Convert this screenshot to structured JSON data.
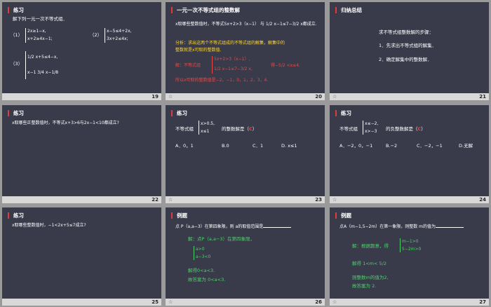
{
  "slides": [
    {
      "number": "19",
      "title": "练习",
      "prompt": "解下列一元一次不等式组．",
      "p1_label": "（1）",
      "p1_l1": "2x≥1−x,",
      "p1_l2": "x+2≥4x−1;",
      "p2_label": "（2）",
      "p2_l1": "x−5≤4+2x,",
      "p2_l2": "3x+2≤4x;",
      "p3_label": "（3）",
      "p3_l1": "1/2 x+5≤4−x,",
      "p3_l2": "x−1  3/4 x−1/8"
    },
    {
      "number": "20",
      "title": "一元一次不等式组的整数解",
      "q1": "x取哪些整数值时，不等式5x+2>3（x−1） 与  1/2 x−1≤7−3/2 x都成立.",
      "analysis1": "分析：求出这两个不等式组成的不等式组的解集，解集中的",
      "analysis2": "整数就是x可取的整数值.",
      "sol_prefix": "解：不等式组",
      "sol_l1": "5x+2>3（x−1）,",
      "sol_l2": "1/2 x−1≤7−3/2 x,",
      "sol_result": "得−5/2 <x≤4.",
      "conclusion": "所以x可取的整数值是−2，−1，0，1，2，3，4."
    },
    {
      "number": "21",
      "title": "归纳总结",
      "heading": "求不等式组整数解的步骤：",
      "step1": "1．先求出不等式组的解集．",
      "step2": "2．确定解集中的整数解．"
    },
    {
      "number": "22",
      "title": "练习",
      "q": "x取哪些正整数值时，不等式x+3>6与2x−1<10都成立?"
    },
    {
      "number": "23",
      "title": "练习",
      "q_prefix": "不等式组",
      "q_l1": "x>0.5,",
      "q_l2": "x≤1",
      "q_suffix": "的整数解是（",
      "answer": "C",
      "q_close": "）",
      "options": [
        "A．0，1",
        "B.0",
        "C．1",
        "D. x≤1"
      ]
    },
    {
      "number": "24",
      "title": "练习",
      "q_prefix": "不等式组",
      "q_l1": "x≤−2,",
      "q_l2": "x>−3",
      "q_suffix": "的负整数解是（",
      "answer": "C",
      "q_close": "）",
      "options": [
        "A．−2，0，−1",
        "B.−2",
        "C．−2，−1",
        "D.无解"
      ]
    },
    {
      "number": "25",
      "title": "练习",
      "q": "x取哪些整数值时，−1<2x+5≤7成立?"
    },
    {
      "number": "26",
      "title": "例题",
      "q": "点 P（a,a−3）在第四象限，则 a的取值范围是",
      "sol1": "解：点P（a,a−3）在第四象限，",
      "sys_l1": "a>0",
      "sys_l2": "a−3<0",
      "sol2": "解得0<a<3.",
      "sol3": "故答案为 0<a<3."
    },
    {
      "number": "27",
      "title": "例题",
      "q": "点A（m−1,5−2m）在第一象限，则整数 m的值为",
      "sol1": "解：根据题意，得",
      "sys_l1": "m−1>0",
      "sys_l2": "5−2m>0",
      "sol2": "解得 1<m< 5/2",
      "sol3": "则整数m的值为2,",
      "sol4": "故答案为 2."
    }
  ],
  "star_glyph": "☆"
}
